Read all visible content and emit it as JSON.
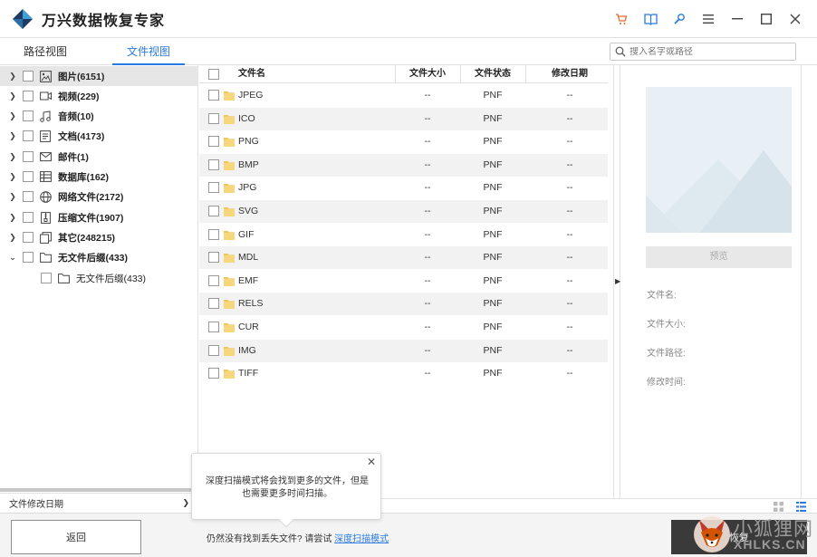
{
  "app": {
    "title": "万兴数据恢复专家"
  },
  "titlebar_icons": [
    "cart-icon",
    "book-icon",
    "wrench-icon",
    "menu-icon",
    "minimize-icon",
    "maximize-icon",
    "close-icon"
  ],
  "tabs": {
    "path_view": "路径视图",
    "file_view": "文件视图",
    "active": "file_view"
  },
  "search": {
    "placeholder": "搜入名字或路径"
  },
  "tree": [
    {
      "label": "图片(6151)",
      "icon": "image-icon",
      "expanded": false,
      "selected": true
    },
    {
      "label": "视频(229)",
      "icon": "video-icon",
      "expanded": false
    },
    {
      "label": "音频(10)",
      "icon": "music-icon",
      "expanded": false
    },
    {
      "label": "文档(4173)",
      "icon": "document-icon",
      "expanded": false
    },
    {
      "label": "邮件(1)",
      "icon": "mail-icon",
      "expanded": false
    },
    {
      "label": "数据库(162)",
      "icon": "database-icon",
      "expanded": false
    },
    {
      "label": "网络文件(2172)",
      "icon": "globe-icon",
      "expanded": false
    },
    {
      "label": "压缩文件(1907)",
      "icon": "archive-icon",
      "expanded": false
    },
    {
      "label": "其它(248215)",
      "icon": "other-icon",
      "expanded": false
    },
    {
      "label": "无文件后缀(433)",
      "icon": "folder-icon",
      "expanded": true
    }
  ],
  "tree_child": {
    "label": "无文件后缀(433)",
    "icon": "folder-icon"
  },
  "sort": {
    "label": "文件修改日期"
  },
  "table": {
    "headers": {
      "name": "文件名",
      "size": "文件大小",
      "status": "文件状态",
      "date": "修改日期"
    },
    "rows": [
      {
        "name": "JPEG",
        "size": "--",
        "status": "PNF",
        "date": "--"
      },
      {
        "name": "ICO",
        "size": "--",
        "status": "PNF",
        "date": "--"
      },
      {
        "name": "PNG",
        "size": "--",
        "status": "PNF",
        "date": "--"
      },
      {
        "name": "BMP",
        "size": "--",
        "status": "PNF",
        "date": "--"
      },
      {
        "name": "JPG",
        "size": "--",
        "status": "PNF",
        "date": "--"
      },
      {
        "name": "SVG",
        "size": "--",
        "status": "PNF",
        "date": "--"
      },
      {
        "name": "GIF",
        "size": "--",
        "status": "PNF",
        "date": "--"
      },
      {
        "name": "MDL",
        "size": "--",
        "status": "PNF",
        "date": "--"
      },
      {
        "name": "EMF",
        "size": "--",
        "status": "PNF",
        "date": "--"
      },
      {
        "name": "RELS",
        "size": "--",
        "status": "PNF",
        "date": "--"
      },
      {
        "name": "CUR",
        "size": "--",
        "status": "PNF",
        "date": "--"
      },
      {
        "name": "IMG",
        "size": "--",
        "status": "PNF",
        "date": "--"
      },
      {
        "name": "TIFF",
        "size": "--",
        "status": "PNF",
        "date": "--"
      }
    ]
  },
  "preview": {
    "button": "预览",
    "fields": {
      "name": "文件名:",
      "size": "文件大小:",
      "path": "文件路径:",
      "date": "修改时间:"
    }
  },
  "popup": {
    "text": "深度扫描模式将会找到更多的文件，但是也需要更多时间扫描。"
  },
  "footer": {
    "back": "返回",
    "tip": "仍然没有找到丢失文件? 请尝试 ",
    "tip_link": "深度扫描模式",
    "recover": "恢复"
  },
  "watermark": {
    "line1": "小狐狸网",
    "line2": "XHLKS.CN"
  },
  "colors": {
    "accent": "#2a7ae2",
    "folder": "#f0c75e",
    "recover_bg": "#3a3a3a"
  }
}
